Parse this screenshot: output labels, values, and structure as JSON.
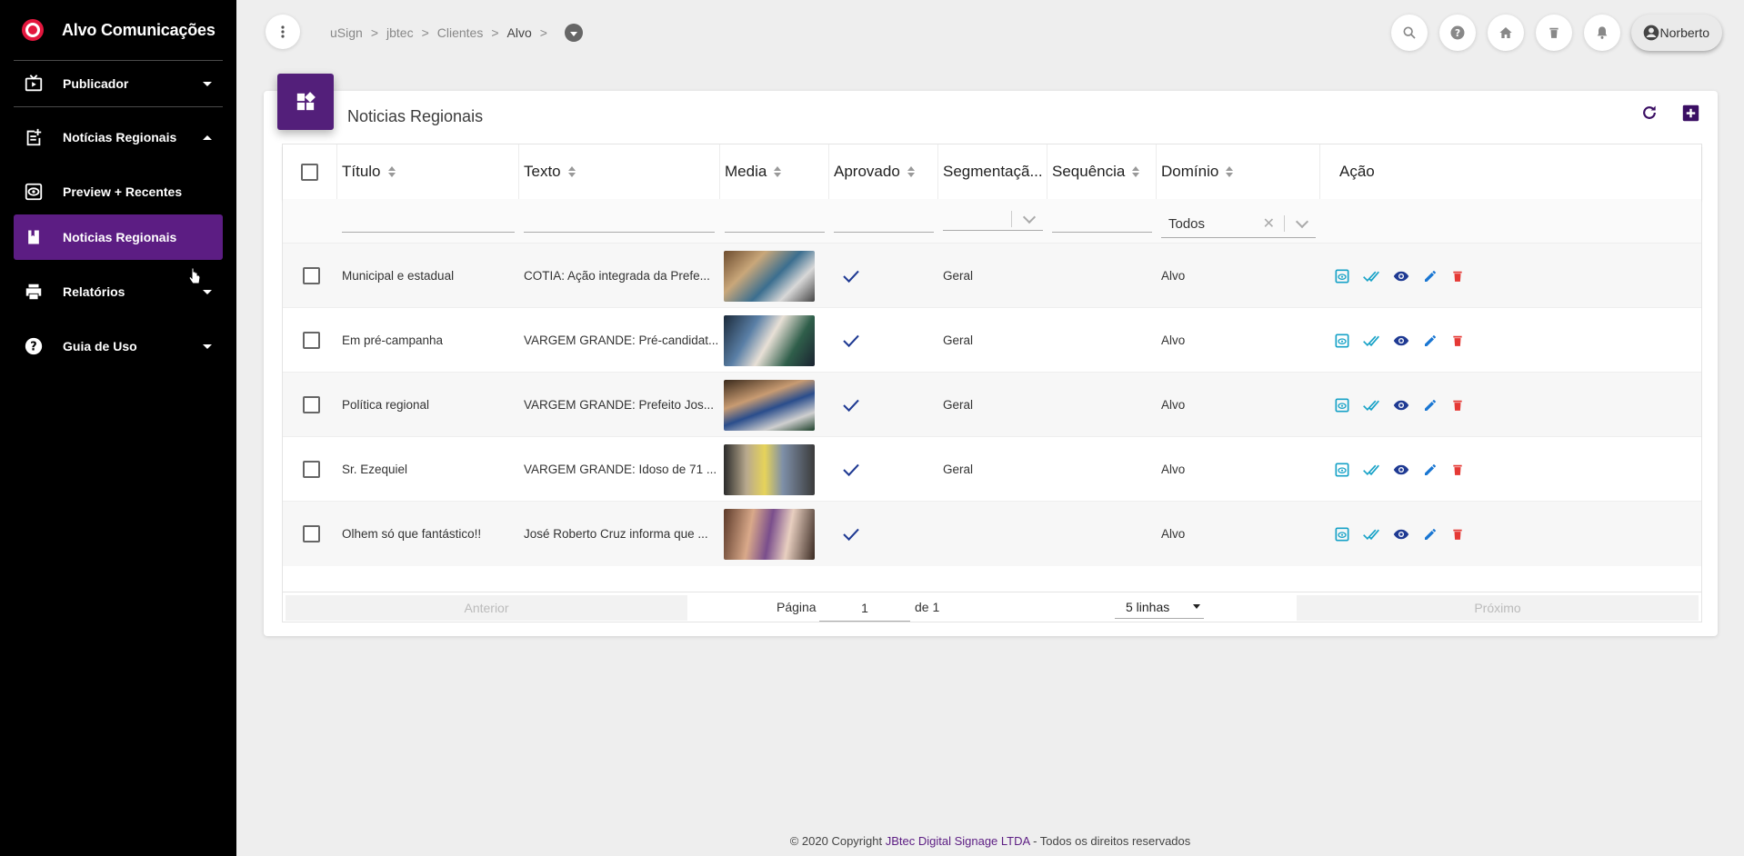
{
  "brand": {
    "title": "Alvo Comunicações"
  },
  "sidebar": {
    "items": [
      {
        "label": "Publicador"
      },
      {
        "label": "Notícias Regionais"
      },
      {
        "label": "Preview + Recentes"
      },
      {
        "label": "Noticias Regionais"
      },
      {
        "label": "Relatórios"
      },
      {
        "label": "Guia de Uso"
      }
    ]
  },
  "breadcrumb": {
    "items": [
      "uSign",
      ">",
      "jbtec",
      ">",
      "Clientes",
      ">",
      "Alvo",
      ">"
    ]
  },
  "user": {
    "name": "Norberto"
  },
  "card": {
    "title": "Noticias Regionais"
  },
  "table": {
    "columns": [
      "Título",
      "Texto",
      "Media",
      "Aprovado",
      "Segmentaçã...",
      "Sequência",
      "Domínio",
      "Ação"
    ],
    "domain_filter": "Todos",
    "rows": [
      {
        "titulo": "Municipal e estadual",
        "texto": "COTIA: Ação integrada da Prefe...",
        "aprovado": true,
        "segmentacao": "Geral",
        "sequencia": "",
        "dominio": "Alvo"
      },
      {
        "titulo": "Em pré-campanha",
        "texto": "VARGEM GRANDE: Pré-candidat...",
        "aprovado": true,
        "segmentacao": "Geral",
        "sequencia": "",
        "dominio": "Alvo"
      },
      {
        "titulo": "Política regional",
        "texto": "VARGEM GRANDE: Prefeito Jos...",
        "aprovado": true,
        "segmentacao": "Geral",
        "sequencia": "",
        "dominio": "Alvo"
      },
      {
        "titulo": "Sr. Ezequiel",
        "texto": "VARGEM GRANDE: Idoso de 71 ...",
        "aprovado": true,
        "segmentacao": "Geral",
        "sequencia": "",
        "dominio": "Alvo"
      },
      {
        "titulo": "Olhem só que fantástico!!",
        "texto": "José Roberto Cruz informa que ...",
        "aprovado": true,
        "segmentacao": "",
        "sequencia": "",
        "dominio": "Alvo"
      }
    ]
  },
  "pagination": {
    "prev_label": "Anterior",
    "page_label": "Página",
    "page_value": "1",
    "of_label": "de 1",
    "rows_label": "5 linhas",
    "next_label": "Próximo"
  },
  "footer": {
    "prefix": "© 2020 Copyright",
    "company": "JBtec Digital Signage LTDA",
    "suffix": "- Todos os direitos reservados"
  },
  "colors": {
    "brand": "#5c1d83",
    "accent_cyan": "#17a2c7",
    "delete_red": "#e53935",
    "check_blue": "#1f3a93"
  }
}
